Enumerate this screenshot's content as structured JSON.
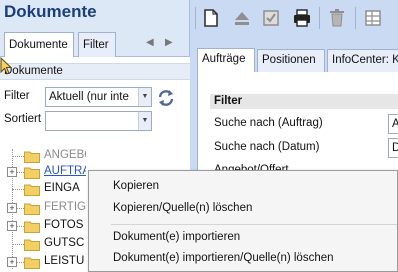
{
  "left_panel": {
    "title": "Dokumente",
    "tabs": [
      {
        "label": "Dokumente",
        "active": true
      },
      {
        "label": "Filter",
        "active": false
      }
    ],
    "section_header": "Dokumente",
    "filter": {
      "label": "Filter",
      "value": "Aktuell (nur inte"
    },
    "sort": {
      "label": "Sortiert",
      "value": ""
    },
    "tree": [
      {
        "label": "ANGEBOT",
        "style": "grey",
        "expandable": false
      },
      {
        "label": "AUFTRAG",
        "style": "link",
        "expandable": true
      },
      {
        "label": "EINGA",
        "style": "normal",
        "expandable": false
      },
      {
        "label": "FERTIG",
        "style": "grey",
        "expandable": true
      },
      {
        "label": "FOTOS",
        "style": "normal",
        "expandable": true
      },
      {
        "label": "GUTSC",
        "style": "normal",
        "expandable": false
      },
      {
        "label": "LEISTU",
        "style": "normal",
        "expandable": true
      }
    ]
  },
  "toolbar": {
    "icons": [
      "new-document-icon",
      "eject-icon",
      "checkbox-icon",
      "print-icon",
      "delete-icon",
      "grid-icon"
    ]
  },
  "right_panel": {
    "tabs": [
      {
        "label": "Aufträge",
        "active": true
      },
      {
        "label": "Positionen",
        "active": false
      },
      {
        "label": "InfoCenter: Kun",
        "active": false
      }
    ],
    "section_title": "Filter",
    "rows": [
      {
        "label": "Suche nach (Auftrag)",
        "value": "A"
      },
      {
        "label": "Suche nach (Datum)",
        "value": "D"
      },
      {
        "label": "Angebot/Offert",
        "value": ""
      }
    ]
  },
  "context_menu": {
    "items": [
      {
        "label": "Kopieren"
      },
      {
        "label": "Kopieren/Quelle(n) löschen"
      },
      {
        "label": "Dokument(e) importieren"
      },
      {
        "label": "Dokument(e) importieren/Quelle(n) löschen"
      }
    ]
  },
  "colors": {
    "pane_bg": "#c9daf2",
    "title": "#1c3f7a",
    "link": "#2a55c9",
    "folder": "#f2cf62"
  }
}
